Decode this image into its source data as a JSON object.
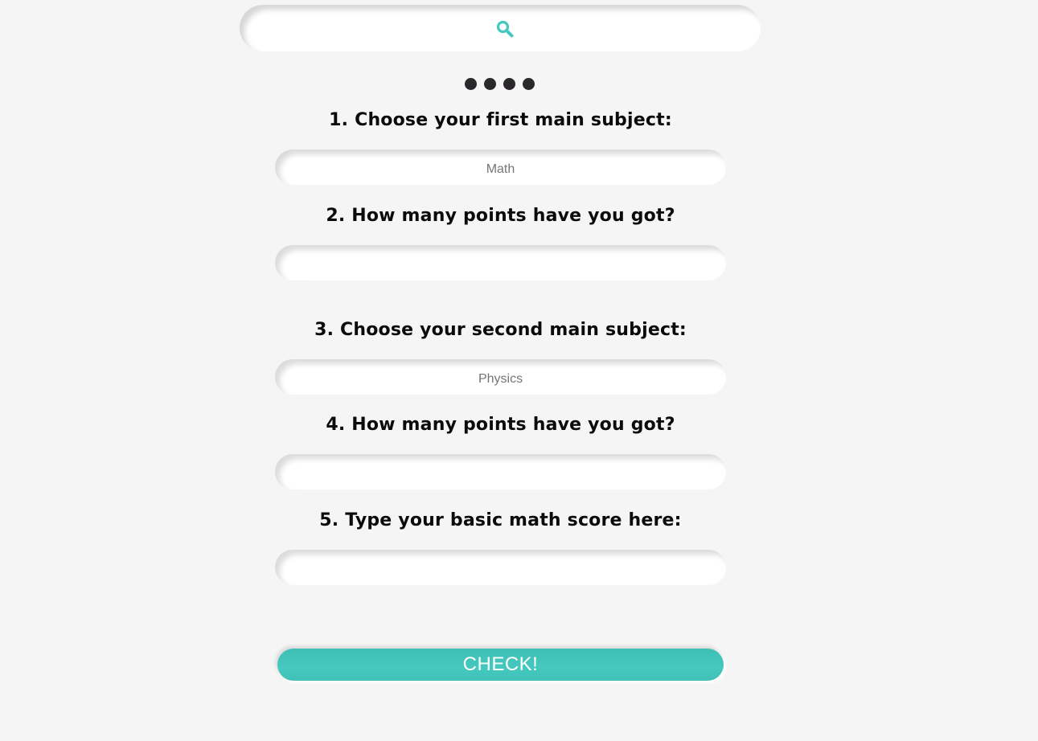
{
  "search": {
    "icon": "search-icon",
    "accent_color": "#45c8be"
  },
  "pager": {
    "dot_count": 4,
    "dot_color": "#2b282c"
  },
  "questions": [
    {
      "label": "1. Choose your first main subject:",
      "placeholder": "Math",
      "value": ""
    },
    {
      "label": "2. How many points have you got?",
      "placeholder": "",
      "value": ""
    },
    {
      "label": "3. Choose your second main subject:",
      "placeholder": "Physics",
      "value": ""
    },
    {
      "label": "4. How many points have you got?",
      "placeholder": "",
      "value": ""
    },
    {
      "label": "5. Type your basic math score here:",
      "placeholder": "",
      "value": ""
    }
  ],
  "check_button": {
    "label": "CHECK!",
    "color": "#45c8be"
  }
}
